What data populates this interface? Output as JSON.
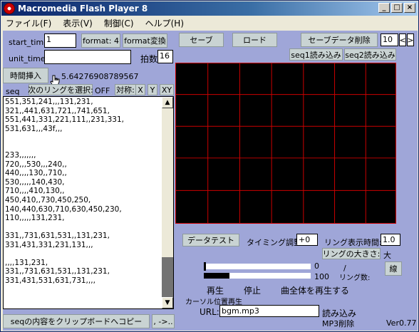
{
  "window": {
    "title": "Macromedia Flash Player 8"
  },
  "menu": [
    "ファイル(F)",
    "表示(V)",
    "制御(C)",
    "ヘルプ(H)"
  ],
  "controls": {
    "start_time_label": "start_time",
    "start_time_value": "1",
    "format_label": "format: 4",
    "format_convert": "format変換",
    "save": "セーブ",
    "load": "ロード",
    "save_delete": "セーブデータ削除",
    "slot_value": "10",
    "prev": "<",
    "next": ">",
    "seq1_load": "seq1読み込み",
    "seq2_load": "seq2読み込み",
    "unit_time_label": "unit_time",
    "unit_time_value": "",
    "beat_label": "拍数",
    "beat_value": "16",
    "insert_time": "時間挿入",
    "time_readout": "5.64276908789567",
    "seq_label": "seq",
    "next_ring": "次のリングを選択:",
    "ring_state": "OFF",
    "symmetry": "対称:",
    "x": "X",
    "y": "Y",
    "xy": "XY"
  },
  "seq_lines": [
    "551,351,241,,,131,231,",
    "321,,441,631,721,,741,651,",
    "551,441,331,221,111,,231,331,",
    "531,631,,,43f,,,",
    "",
    "",
    "233,,,,,,,",
    "720,,,530,,,240,,",
    "440,,,,130,,710,,",
    "530,,,,,140,430,",
    "710,,,,410,130,,",
    "450,410,,730,450,250,",
    "140,440,630,710,630,450,230,",
    "110,,,,,131,231,",
    "",
    "331,,731,631,531,,131,231,",
    "331,431,331,231,131,,,",
    "",
    ",,,,131,231,",
    "331,,731,631,531,,131,231,",
    "331,431,531,631,731,,,,",
    ""
  ],
  "lower": {
    "data_test": "データテスト",
    "timing_adjust": "タイミング調整:",
    "timing_value": "+0",
    "ring_time_label": "リング表示時間:",
    "ring_time_value": "1.0",
    "ring_size_label": "リングの大きさ:",
    "ring_size_value": "大",
    "slider1_value": "0",
    "slider2_value": "100",
    "slash": "/",
    "ring_count_label": "リング数:",
    "line_button": "線",
    "play": "再生",
    "stop": "停止",
    "play_all": "曲全体を再生する",
    "cursor_play": "カーソル位置再生",
    "url_label": "URL:",
    "url_value": "bgm.mp3",
    "load_mp3": "読み込み",
    "delete_mp3": "MP3削除",
    "copy_clipboard": "seqの内容をクリップボードへコピー",
    "arrow_btn": ", ->..",
    "version": "Ver0.77"
  },
  "sliders": {
    "volume_fraction": 0.0,
    "position_fraction": 0.24
  },
  "colors": {
    "stage": "#9fa6d8",
    "grid_line": "#cc0000",
    "button": "#c9d3d3"
  }
}
